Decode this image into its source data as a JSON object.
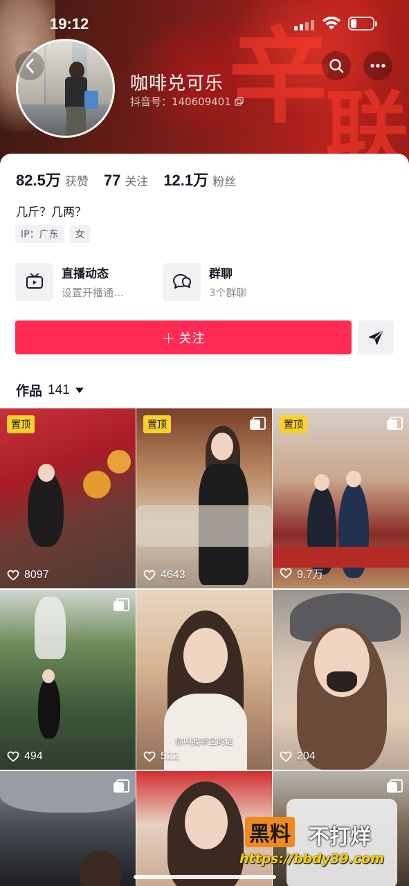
{
  "status_bar": {
    "time": "19:12",
    "battery_level": 0.25
  },
  "profile": {
    "nickname": "咖啡兑可乐",
    "douyin_id": "抖音号：140609401"
  },
  "stats": [
    {
      "value": "82.5万",
      "label": "获赞"
    },
    {
      "value": "77",
      "label": "关注"
    },
    {
      "value": "12.1万",
      "label": "粉丝"
    }
  ],
  "bio": "几斤？几两？",
  "tags": [
    "IP：广东",
    "女"
  ],
  "entries": [
    {
      "title": "直播动态",
      "subtitle": "设置开播通…",
      "icon": "tv-icon"
    },
    {
      "title": "群聊",
      "subtitle": "3个群聊",
      "icon": "chat-bubble-icon"
    }
  ],
  "actions": {
    "follow_label": "关注",
    "follow_plus": "+"
  },
  "works": {
    "label": "作品",
    "count": "141"
  },
  "videos": [
    {
      "likes": "8097",
      "pinned_label": "置顶",
      "multi": false
    },
    {
      "likes": "4643",
      "pinned_label": "置顶",
      "multi": true
    },
    {
      "likes": "9.7万",
      "pinned_label": "置顶",
      "multi": true
    },
    {
      "likes": "494",
      "pinned_label": "",
      "multi": true
    },
    {
      "likes": "522",
      "pinned_label": "",
      "multi": false,
      "caption": "你叫我乖宝的话"
    },
    {
      "likes": "204",
      "pinned_label": "",
      "multi": false
    },
    {
      "likes": "",
      "pinned_label": "",
      "multi": true
    },
    {
      "likes": "",
      "pinned_label": "",
      "multi": false
    },
    {
      "likes": "",
      "pinned_label": "",
      "multi": true
    }
  ],
  "watermark": {
    "left": "黑料",
    "right": "不打烊",
    "url": "https://bbdy39.com"
  }
}
